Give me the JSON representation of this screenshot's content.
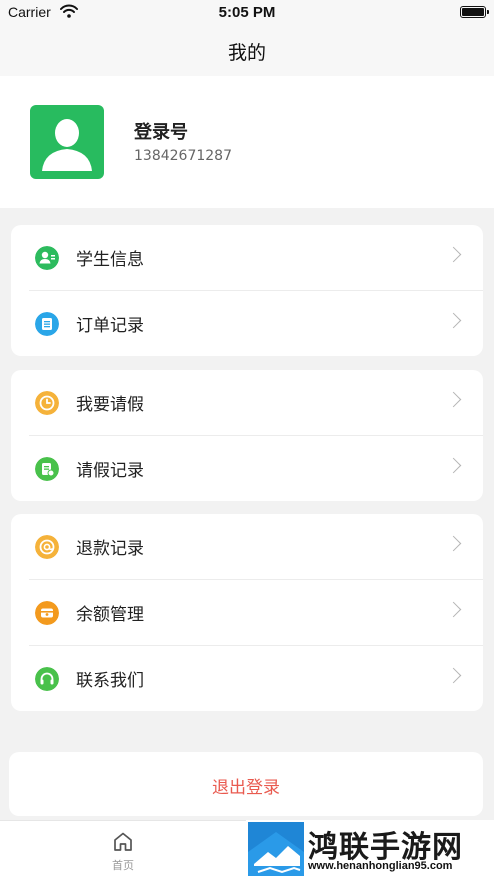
{
  "status_bar": {
    "carrier": "Carrier",
    "time": "5:05 PM"
  },
  "nav": {
    "title": "我的"
  },
  "profile": {
    "name": "登录号",
    "phone": "13842671287"
  },
  "menu_groups": [
    {
      "items": [
        {
          "label": "学生信息",
          "icon": "student-info-icon",
          "color": "#2dbb5e"
        },
        {
          "label": "订单记录",
          "icon": "order-list-icon",
          "color": "#2aa6e8"
        }
      ]
    },
    {
      "items": [
        {
          "label": "我要请假",
          "icon": "clock-icon",
          "color": "#f5b23a"
        },
        {
          "label": "请假记录",
          "icon": "leave-record-icon",
          "color": "#49c14b"
        }
      ]
    },
    {
      "items": [
        {
          "label": "退款记录",
          "icon": "refund-icon",
          "color": "#f5b23a"
        },
        {
          "label": "余额管理",
          "icon": "balance-icon",
          "color": "#f39a1e"
        },
        {
          "label": "联系我们",
          "icon": "headset-icon",
          "color": "#49c14b"
        }
      ]
    }
  ],
  "logout": {
    "label": "退出登录",
    "color": "#e95a4f"
  },
  "tabbar": {
    "home_label": "首页"
  },
  "watermark": {
    "title": "鸿联手游网",
    "url": "www.henanhonglian95.com"
  }
}
